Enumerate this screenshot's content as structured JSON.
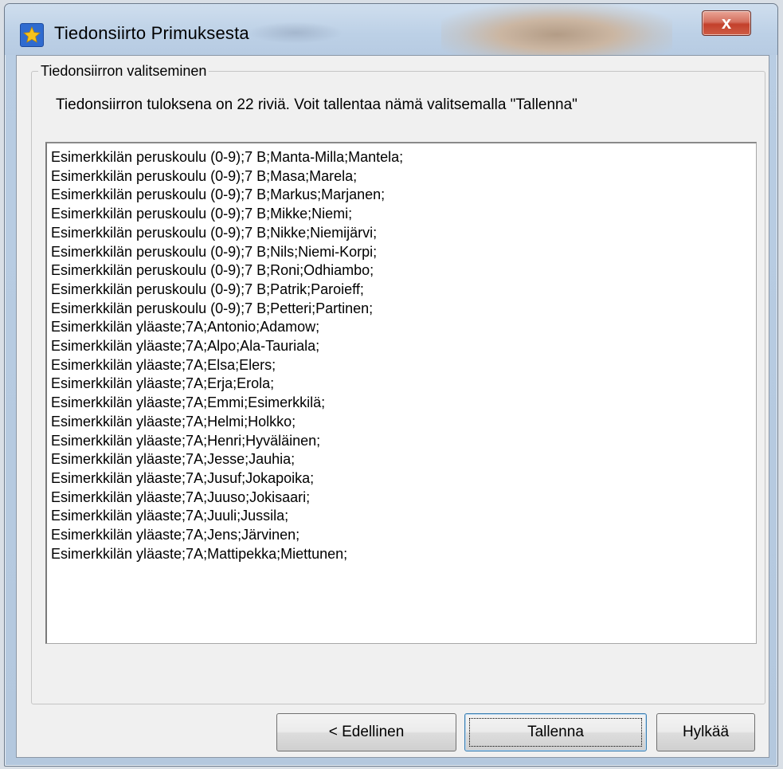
{
  "window": {
    "title": "Tiedonsiirto Primuksesta",
    "close_glyph": "x"
  },
  "icons": {
    "app": "star-app-icon",
    "close": "close-icon"
  },
  "group": {
    "legend": "Tiedonsiirron valitseminen",
    "info": "Tiedonsiirron tuloksena on 22 riviä. Voit tallentaa nämä valitsemalla \"Tallenna\""
  },
  "result_lines": [
    "Esimerkkilän peruskoulu (0-9);7 B;Manta-Milla;Mantela;",
    "Esimerkkilän peruskoulu (0-9);7 B;Masa;Marela;",
    "Esimerkkilän peruskoulu (0-9);7 B;Markus;Marjanen;",
    "Esimerkkilän peruskoulu (0-9);7 B;Mikke;Niemi;",
    "Esimerkkilän peruskoulu (0-9);7 B;Nikke;Niemijärvi;",
    "Esimerkkilän peruskoulu (0-9);7 B;Nils;Niemi-Korpi;",
    "Esimerkkilän peruskoulu (0-9);7 B;Roni;Odhiambo;",
    "Esimerkkilän peruskoulu (0-9);7 B;Patrik;Paroieff;",
    "Esimerkkilän peruskoulu (0-9);7 B;Petteri;Partinen;",
    "Esimerkkilän yläaste;7A;Antonio;Adamow;",
    "Esimerkkilän yläaste;7A;Alpo;Ala-Tauriala;",
    "Esimerkkilän yläaste;7A;Elsa;Elers;",
    "Esimerkkilän yläaste;7A;Erja;Erola;",
    "Esimerkkilän yläaste;7A;Emmi;Esimerkkilä;",
    "Esimerkkilän yläaste;7A;Helmi;Holkko;",
    "Esimerkkilän yläaste;7A;Henri;Hyväläinen;",
    "Esimerkkilän yläaste;7A;Jesse;Jauhia;",
    "Esimerkkilän yläaste;7A;Jusuf;Jokapoika;",
    "Esimerkkilän yläaste;7A;Juuso;Jokisaari;",
    "Esimerkkilän yläaste;7A;Juuli;Jussila;",
    "Esimerkkilän yläaste;7A;Jens;Järvinen;",
    "Esimerkkilän yläaste;7A;Mattipekka;Miettunen;"
  ],
  "buttons": {
    "previous": "< Edellinen",
    "save": "Tallenna",
    "cancel": "Hylkää"
  },
  "colors": {
    "titlebar": "#bcd0e6",
    "close_button": "#c3402b",
    "dialog_background": "#f0f0f0",
    "text_area_background": "#ffffff"
  }
}
